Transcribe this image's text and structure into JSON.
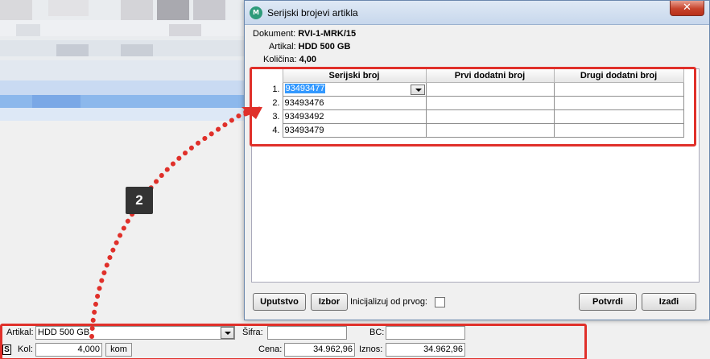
{
  "dialog": {
    "title": "Serijski brojevi artikla",
    "close_label": "✕",
    "icon_label": "M",
    "info": {
      "dokument_label": "Dokument:",
      "dokument_value": "RVI-1-MRK/15",
      "artikal_label": "Artikal:",
      "artikal_value": "HDD 500 GB",
      "kolicina_label": "Količina:",
      "kolicina_value": "4,00"
    },
    "grid": {
      "columns": [
        "Serijski broj",
        "Prvi dodatni broj",
        "Drugi dodatni broj"
      ],
      "rows": [
        {
          "num": "1.",
          "serial": "93493477",
          "first": "",
          "second": ""
        },
        {
          "num": "2.",
          "serial": "93493476",
          "first": "",
          "second": ""
        },
        {
          "num": "3.",
          "serial": "93493492",
          "first": "",
          "second": ""
        },
        {
          "num": "4.",
          "serial": "93493479",
          "first": "",
          "second": ""
        }
      ]
    },
    "buttons": {
      "uputstvo": "Uputstvo",
      "izbor": "Izbor",
      "inicijalizuj_label": "Inicijalizuj od prvog:",
      "potvrdi": "Potvrdi",
      "izadji": "Izađi"
    }
  },
  "form": {
    "artikal_label": "Artikal:",
    "artikal_value": "HDD 500 GB",
    "sifra_label": "Šifra:",
    "sifra_value": "",
    "bc_label": "BC:",
    "bc_value": "",
    "s_badge": "S",
    "kol_label": "Kol:",
    "kol_value": "4,000",
    "unit_label": "kom",
    "cena_label": "Cena:",
    "cena_value": "34.962,96",
    "iznos_label": "Iznos:",
    "iznos_value": "34.962,96"
  },
  "annotation": {
    "step_number": "2",
    "color": "#e0302a"
  },
  "colors": {
    "selection": "#3399ff",
    "titlebar": "#c7d7ec",
    "close": "#c7432b"
  }
}
